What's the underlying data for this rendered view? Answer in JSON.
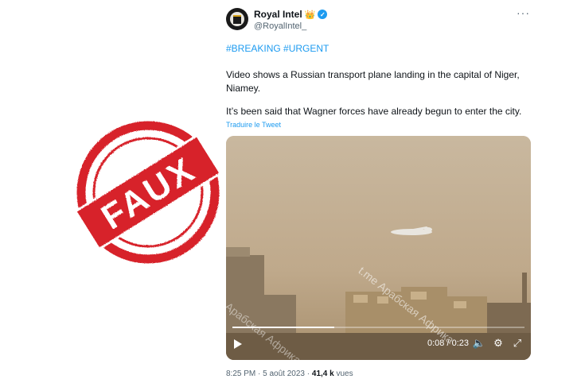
{
  "stamp": {
    "text": "FAUX",
    "color": "#d7232a"
  },
  "tweet": {
    "author": {
      "name": "Royal Intel",
      "crown": "👑",
      "handle": "@RoyalIntel_"
    },
    "hashtags": "#BREAKING #URGENT",
    "paragraph1": "Video shows a Russian transport plane landing in the capital of Niger, Niamey.",
    "paragraph2": "It’s been said that Wagner forces have already begun to enter the city.",
    "translate_label": "Traduire le Tweet",
    "video": {
      "watermark": "t.me Арабская Африка",
      "current_time": "0:08",
      "separator": "/",
      "duration": "0:23",
      "progress": 0.35
    },
    "time": "8:25 PM",
    "dot": "·",
    "date": "5 août 2023",
    "views_count": "41,4 k",
    "views_label": "vues"
  },
  "colors": {
    "link": "#1d9bf0",
    "verified": "#1d9bf0",
    "stamp": "#d7232a",
    "muted": "#536471"
  }
}
